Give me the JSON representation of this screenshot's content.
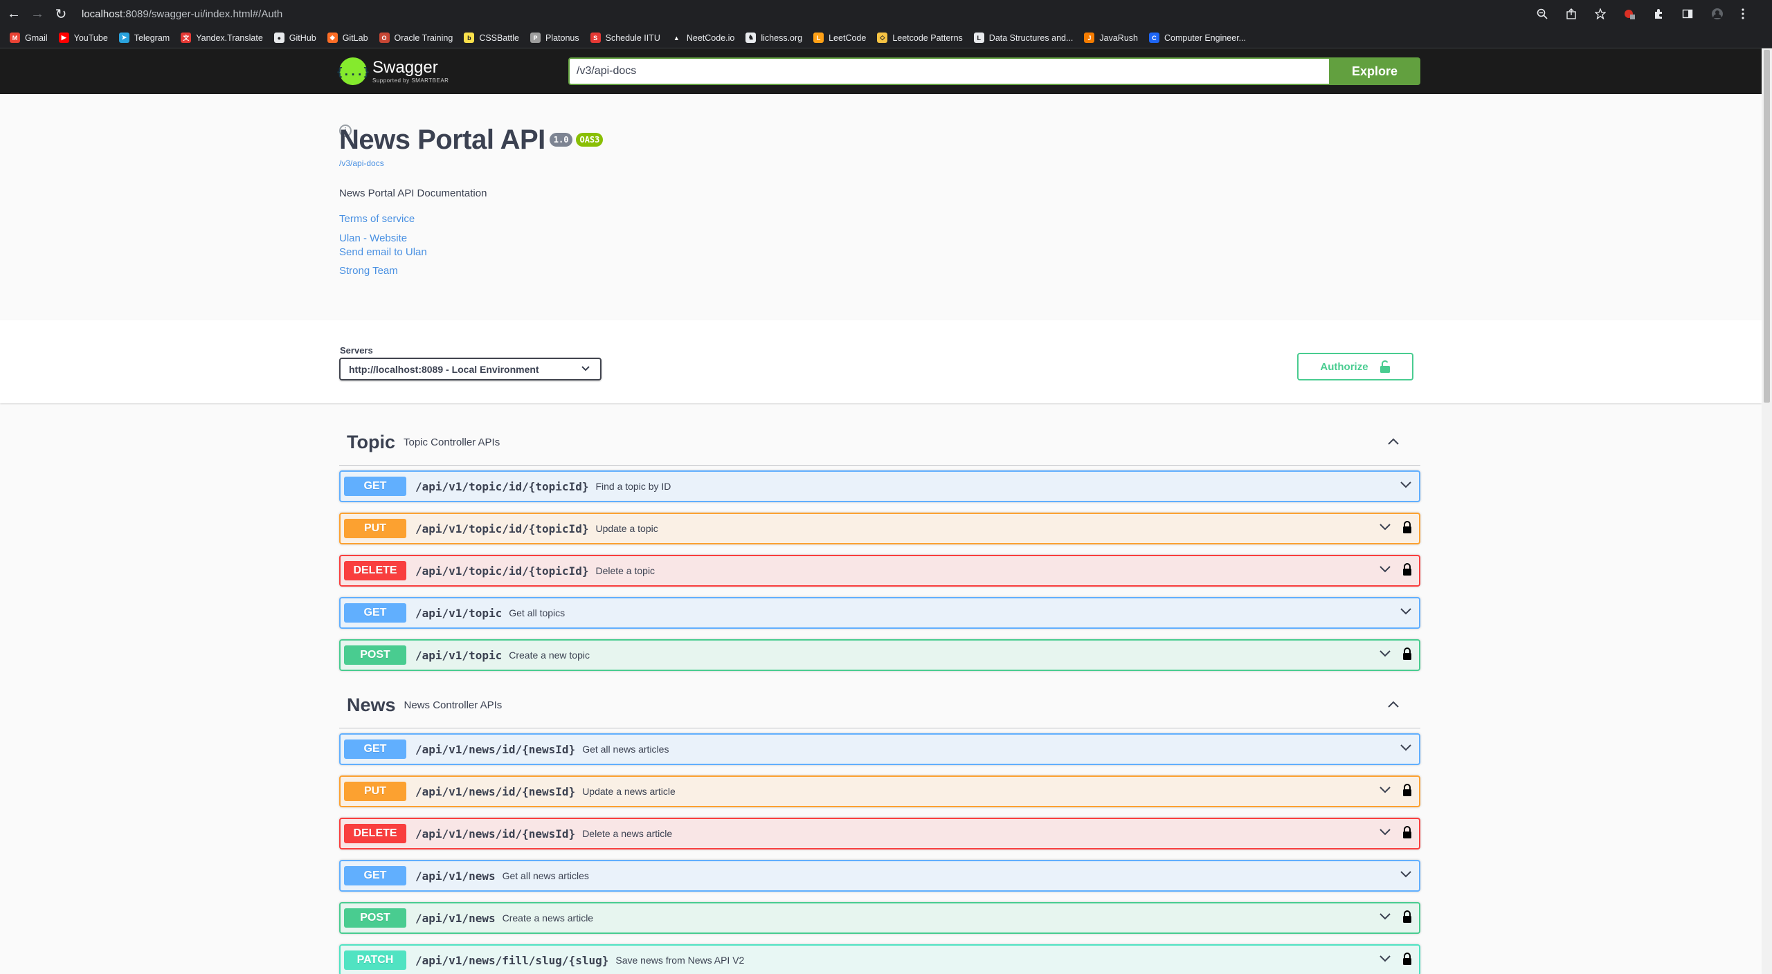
{
  "browser": {
    "url_host": "localhost",
    "url_rest": ":8089/swagger-ui/index.html#/Auth",
    "bookmarks": [
      {
        "label": "Gmail",
        "color": "#ea4335",
        "glyph": "M"
      },
      {
        "label": "YouTube",
        "color": "#ff0000",
        "glyph": "▶"
      },
      {
        "label": "Telegram",
        "color": "#2aa3de",
        "glyph": "➤"
      },
      {
        "label": "Yandex.Translate",
        "color": "#e53935",
        "glyph": "文"
      },
      {
        "label": "GitHub",
        "color": "#e8eaed",
        "glyph": "●"
      },
      {
        "label": "GitLab",
        "color": "#fc6d26",
        "glyph": "◆"
      },
      {
        "label": "Oracle Training",
        "color": "#c74634",
        "glyph": "O"
      },
      {
        "label": "CSSBattle",
        "color": "#f9e04b",
        "glyph": "b"
      },
      {
        "label": "Platonus",
        "color": "#9e9e9e",
        "glyph": "P"
      },
      {
        "label": "Schedule IITU",
        "color": "#e53935",
        "glyph": "S"
      },
      {
        "label": "NeetCode.io",
        "color": "#202124",
        "glyph": "▲"
      },
      {
        "label": "lichess.org",
        "color": "#e8eaed",
        "glyph": "♞"
      },
      {
        "label": "LeetCode",
        "color": "#ffa116",
        "glyph": "L"
      },
      {
        "label": "Leetcode Patterns",
        "color": "#f6c343",
        "glyph": "◇"
      },
      {
        "label": "Data Structures and...",
        "color": "#e8eaed",
        "glyph": "L"
      },
      {
        "label": "JavaRush",
        "color": "#f57c00",
        "glyph": "J"
      },
      {
        "label": "Computer Engineer...",
        "color": "#1e66f5",
        "glyph": "C"
      }
    ]
  },
  "topbar": {
    "logo_text": "Swagger",
    "logo_sub": "Supported by SMARTBEAR",
    "logo_glyph": "{...}",
    "url_value": "/v3/api-docs",
    "explore_label": "Explore"
  },
  "info": {
    "title": "News Portal API",
    "version": "1.0",
    "oas": "OAS3",
    "api_link": "/v3/api-docs",
    "description": "News Portal API Documentation",
    "terms": "Terms of service",
    "website": "Ulan - Website",
    "email": "Send email to Ulan",
    "license": "Strong Team"
  },
  "servers": {
    "label": "Servers",
    "selected": "http://localhost:8089 - Local Environment",
    "authorize_label": "Authorize"
  },
  "tags": [
    {
      "name": "Topic",
      "description": "Topic Controller APIs",
      "operations": [
        {
          "method": "GET",
          "path": "/api/v1/topic/id/{topicId}",
          "summary": "Find a topic by ID",
          "locked": false
        },
        {
          "method": "PUT",
          "path": "/api/v1/topic/id/{topicId}",
          "summary": "Update a topic",
          "locked": true
        },
        {
          "method": "DELETE",
          "path": "/api/v1/topic/id/{topicId}",
          "summary": "Delete a topic",
          "locked": true
        },
        {
          "method": "GET",
          "path": "/api/v1/topic",
          "summary": "Get all topics",
          "locked": false
        },
        {
          "method": "POST",
          "path": "/api/v1/topic",
          "summary": "Create a new topic",
          "locked": true
        }
      ]
    },
    {
      "name": "News",
      "description": "News Controller APIs",
      "operations": [
        {
          "method": "GET",
          "path": "/api/v1/news/id/{newsId}",
          "summary": "Get all news articles",
          "locked": false
        },
        {
          "method": "PUT",
          "path": "/api/v1/news/id/{newsId}",
          "summary": "Update a news article",
          "locked": true
        },
        {
          "method": "DELETE",
          "path": "/api/v1/news/id/{newsId}",
          "summary": "Delete a news article",
          "locked": true
        },
        {
          "method": "GET",
          "path": "/api/v1/news",
          "summary": "Get all news articles",
          "locked": false
        },
        {
          "method": "POST",
          "path": "/api/v1/news",
          "summary": "Create a news article",
          "locked": true
        },
        {
          "method": "PATCH",
          "path": "/api/v1/news/fill/slug/{slug}",
          "summary": "Save news from News API V2",
          "locked": true
        }
      ]
    }
  ],
  "colors": {
    "get": "#61affe",
    "put": "#fca130",
    "delete": "#f93e3e",
    "post": "#49cc90",
    "patch": "#50e3c2"
  }
}
